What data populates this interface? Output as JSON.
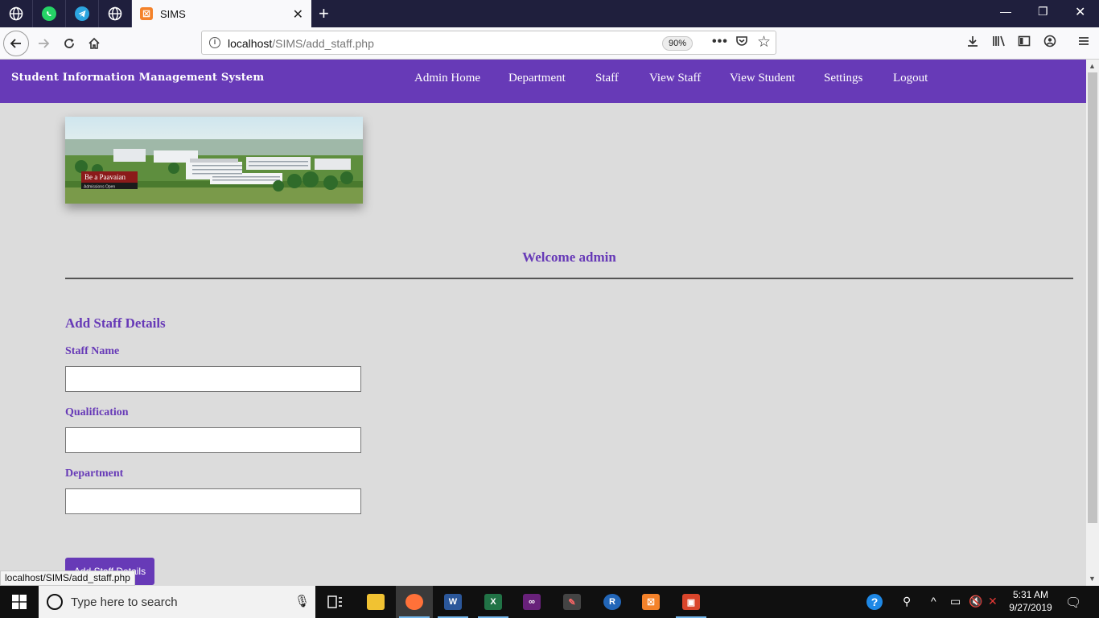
{
  "browser": {
    "tab_title": "SIMS",
    "tab_favicon": "xampp-icon",
    "pinned_tabs": [
      "globe-icon",
      "whatsapp-icon",
      "telegram-icon",
      "globe-icon"
    ],
    "url_host": "localhost",
    "url_path": "/SIMS/add_staff.php",
    "zoom": "90%",
    "status_url": "localhost/SIMS/add_staff.php"
  },
  "header": {
    "brand": "Student Information Management System",
    "menu": [
      "Admin Home",
      "Department",
      "Staff",
      "View Staff",
      "View Student",
      "Settings",
      "Logout"
    ],
    "color": "#673ab7"
  },
  "banner": {
    "caption": "Be a Paavaian",
    "subcaption": "Admissions Open"
  },
  "welcome": "Welcome admin",
  "form": {
    "title": "Add Staff Details",
    "fields": [
      {
        "label": "Staff Name",
        "value": ""
      },
      {
        "label": "Qualification",
        "value": ""
      },
      {
        "label": "Department",
        "value": ""
      }
    ],
    "submit_label": "Add Staff Details"
  },
  "taskbar": {
    "search_placeholder": "Type here to search",
    "time": "5:31 AM",
    "date": "9/27/2019"
  }
}
